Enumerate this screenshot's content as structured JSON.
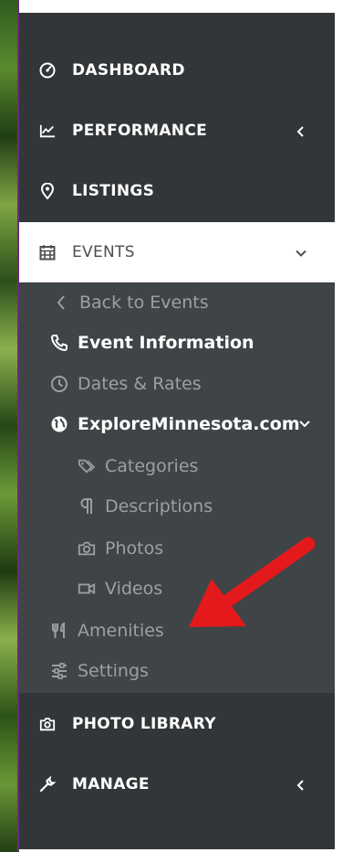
{
  "nav": {
    "dashboard": "DASHBOARD",
    "performance": "PERFORMANCE",
    "listings": "LISTINGS",
    "events": "EVENTS",
    "photo_library": "PHOTO LIBRARY",
    "manage": "MANAGE"
  },
  "events_submenu": {
    "back": "Back to Events",
    "event_information": "Event Information",
    "dates_rates": "Dates & Rates",
    "site": "ExploreMinnesota.com",
    "categories": "Categories",
    "descriptions": "Descriptions",
    "photos": "Photos",
    "videos": "Videos",
    "amenities": "Amenities",
    "settings": "Settings"
  },
  "colors": {
    "sidebar_bg": "#323638",
    "submenu_bg": "#3f4447",
    "active_bg": "#ffffff",
    "muted_text": "#9aa0a4",
    "annotation_arrow": "#e3191b"
  },
  "icons": {
    "dashboard": "gauge-icon",
    "performance": "line-chart-icon",
    "listings": "map-pin-icon",
    "events": "calendar-icon",
    "back": "chevron-left-icon",
    "event_information": "phone-icon",
    "dates_rates": "clock-icon",
    "site": "globe-icon",
    "categories": "tags-icon",
    "descriptions": "paragraph-icon",
    "photos": "camera-icon",
    "videos": "video-icon",
    "amenities": "utensils-icon",
    "settings": "sliders-icon",
    "photo_library": "camera-icon",
    "manage": "wrench-icon"
  }
}
